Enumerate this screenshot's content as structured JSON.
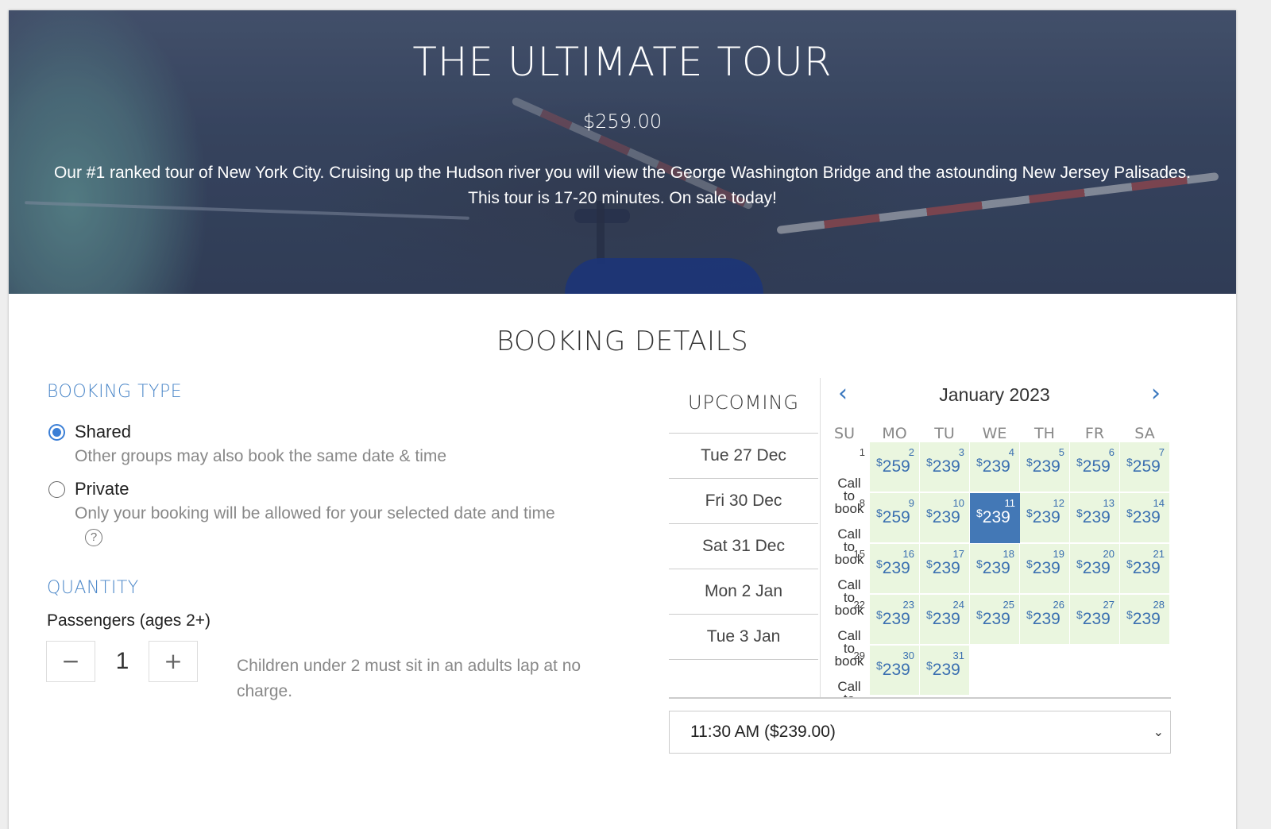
{
  "hero": {
    "title": "THE ULTIMATE TOUR",
    "price": "$259.00",
    "description": "Our #1 ranked tour of New York City. Cruising up the Hudson river you will view the George Washington Bridge and the astounding New Jersey Palisades. This tour is 17-20 minutes. On sale today!"
  },
  "booking": {
    "section_title": "BOOKING DETAILS",
    "type_label": "BOOKING TYPE",
    "shared_label": "Shared",
    "shared_desc": "Other groups may also book the same date & time",
    "private_label": "Private",
    "private_desc": "Only your booking will be allowed for your selected date and time",
    "help_glyph": "?",
    "selected_type": "Shared"
  },
  "quantity": {
    "label": "QUANTITY",
    "passengers_label": "Passengers (ages 2+)",
    "minus": "−",
    "plus": "+",
    "value": "1",
    "note": "Children under 2 must sit in an adults lap at no charge."
  },
  "upcoming": {
    "heading": "UPCOMING",
    "dates": [
      "Tue 27 Dec",
      "Fri 30 Dec",
      "Sat 31 Dec",
      "Mon 2 Jan",
      "Tue 3 Jan"
    ]
  },
  "calendar": {
    "month_title": "January 2023",
    "prev_icon": "chevron-left-icon",
    "next_icon": "chevron-right-icon",
    "weekdays": [
      "SU",
      "MO",
      "TU",
      "WE",
      "TH",
      "FR",
      "SA"
    ],
    "call_to_book": "Call to book",
    "currency": "$",
    "selected_day": 11,
    "weeks": [
      [
        {
          "d": "1",
          "p": null
        },
        {
          "d": "2",
          "p": "259"
        },
        {
          "d": "3",
          "p": "239"
        },
        {
          "d": "4",
          "p": "239"
        },
        {
          "d": "5",
          "p": "239"
        },
        {
          "d": "6",
          "p": "259"
        },
        {
          "d": "7",
          "p": "259"
        }
      ],
      [
        {
          "d": "8",
          "p": null
        },
        {
          "d": "9",
          "p": "259"
        },
        {
          "d": "10",
          "p": "239"
        },
        {
          "d": "11",
          "p": "239"
        },
        {
          "d": "12",
          "p": "239"
        },
        {
          "d": "13",
          "p": "239"
        },
        {
          "d": "14",
          "p": "239"
        }
      ],
      [
        {
          "d": "15",
          "p": null
        },
        {
          "d": "16",
          "p": "239"
        },
        {
          "d": "17",
          "p": "239"
        },
        {
          "d": "18",
          "p": "239"
        },
        {
          "d": "19",
          "p": "239"
        },
        {
          "d": "20",
          "p": "239"
        },
        {
          "d": "21",
          "p": "239"
        }
      ],
      [
        {
          "d": "22",
          "p": null
        },
        {
          "d": "23",
          "p": "239"
        },
        {
          "d": "24",
          "p": "239"
        },
        {
          "d": "25",
          "p": "239"
        },
        {
          "d": "26",
          "p": "239"
        },
        {
          "d": "27",
          "p": "239"
        },
        {
          "d": "28",
          "p": "239"
        }
      ],
      [
        {
          "d": "29",
          "p": null
        },
        {
          "d": "30",
          "p": "239"
        },
        {
          "d": "31",
          "p": "239"
        }
      ]
    ]
  },
  "time_select": {
    "value": "11:30 AM ($239.00)",
    "chevron_icon": "chevron-down-icon"
  },
  "colors": {
    "accent": "#4a86c8",
    "available_bg": "#eaf6df",
    "selected_bg": "#4378b6"
  }
}
